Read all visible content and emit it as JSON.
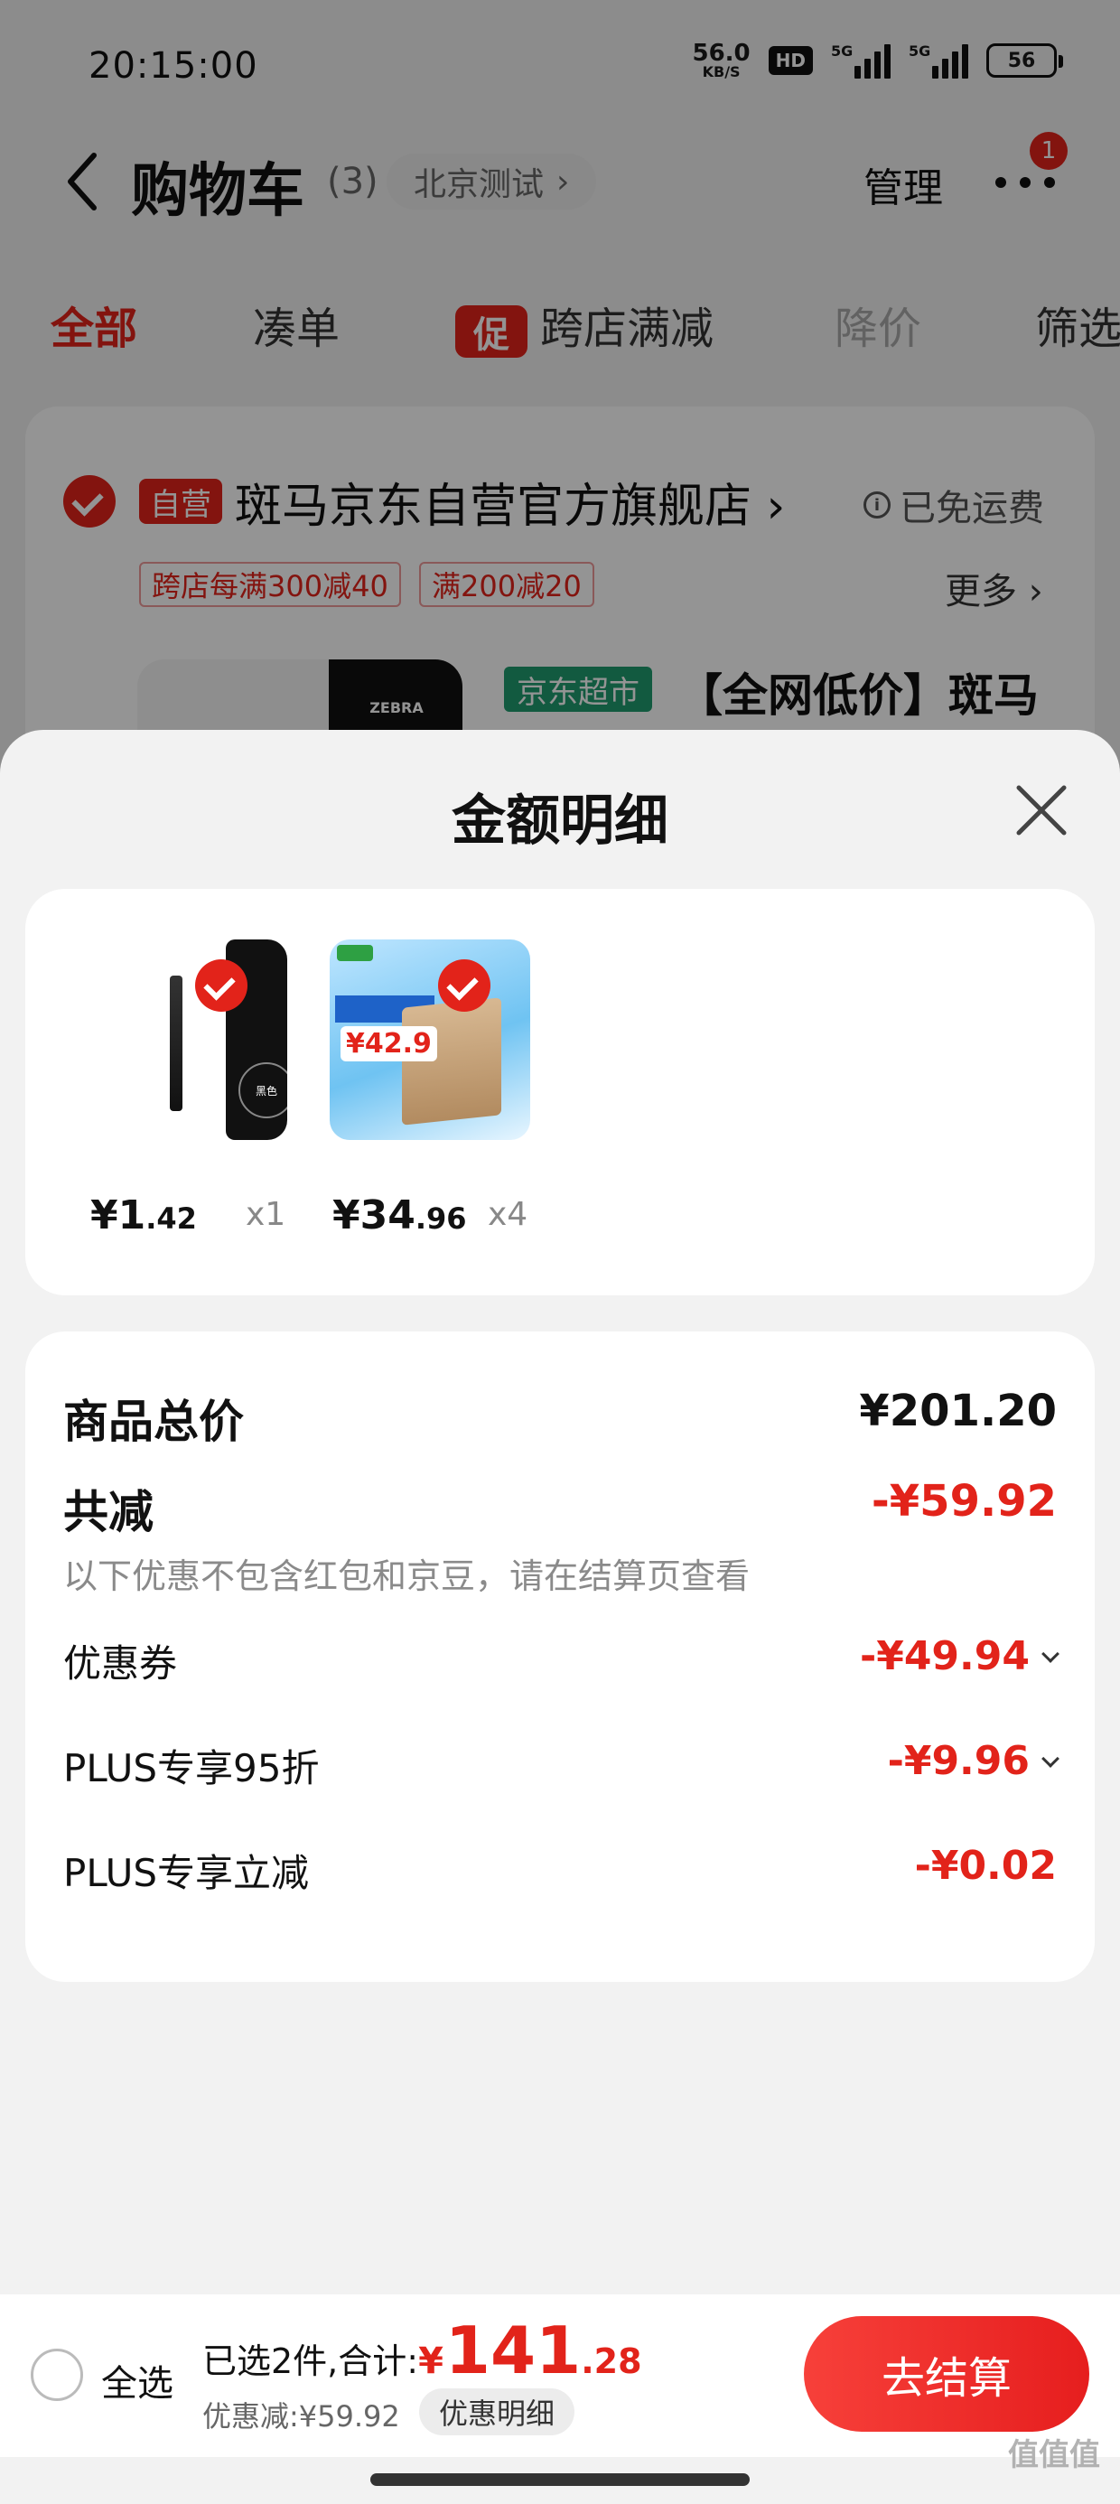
{
  "status_bar": {
    "time": "20:15:00",
    "net_speed": "56.0",
    "net_unit": "KB/S",
    "hd": "HD",
    "sig1_label": "5G",
    "sig2_label": "5G",
    "battery": "56"
  },
  "header": {
    "title": "购物车",
    "count": "(3)",
    "location": "北京测试",
    "manage": "管理",
    "more_badge": "1"
  },
  "tabs": {
    "all": "全部",
    "combine": "凑单",
    "cu_badge": "促",
    "cross_store": "跨店满减",
    "price_drop": "降价",
    "filter": "筛选"
  },
  "store": {
    "self_badge": "自营",
    "name": "斑马京东自营官方旗舰店",
    "shipping": "已免运费",
    "promo1": "跨店每满300减40",
    "promo2": "满200减20",
    "more": "更多",
    "market_badge": "京东超市",
    "product_title": "【全网低价】斑马",
    "box_brand": "ZEBRA"
  },
  "sheet": {
    "title": "金额明细",
    "items": [
      {
        "price_int": "¥1",
        "price_dec": ".42",
        "qty": "x1",
        "box_text": "黑色"
      },
      {
        "price_int": "¥34",
        "price_dec": ".96",
        "qty": "x4",
        "sticker_price": "¥42.9"
      }
    ],
    "detail": {
      "subtotal_label": "商品总价",
      "subtotal_value": "¥201.20",
      "discount_label": "共减",
      "discount_value": "-¥59.92",
      "discount_note": "以下优惠不包含红包和京豆，请在结算页查看",
      "coupon_label": "优惠券",
      "coupon_value": "-¥49.94",
      "plus95_label": "PLUS专享95折",
      "plus95_value": "-¥9.96",
      "plus_cut_label": "PLUS专享立减",
      "plus_cut_value": "-¥0.02"
    }
  },
  "bottom": {
    "select_all": "全选",
    "selected_text": "已选2件,合计:",
    "currency": "¥",
    "total_int": "141",
    "total_dec": ".28",
    "saved": "优惠减:¥59.92",
    "detail_pill": "优惠明细",
    "checkout": "去结算"
  },
  "watermark": "值值值",
  "colors": {
    "accent": "#e2231a",
    "market_green": "#1f9b6f"
  }
}
